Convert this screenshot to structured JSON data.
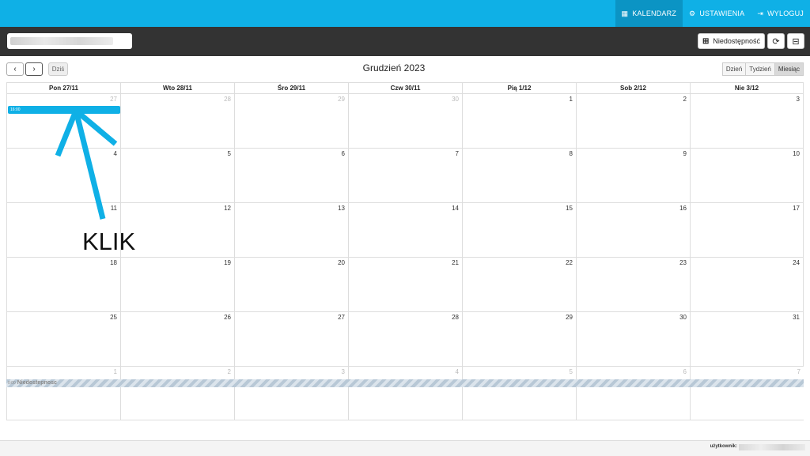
{
  "nav": {
    "items": [
      {
        "label": "KALENDARZ",
        "icon": "calendar-icon",
        "glyph": "▦",
        "active": true
      },
      {
        "label": "USTAWIENIA",
        "icon": "gears-icon",
        "glyph": "⚙",
        "active": false
      },
      {
        "label": "WYLOGUJ",
        "icon": "sign-out-icon",
        "glyph": "⇥",
        "active": false
      }
    ]
  },
  "toolbar": {
    "search_value": "",
    "unavailability_label": "Niedostępność",
    "unavailability_icon": "plus-square-icon",
    "refresh_icon": "refresh-icon",
    "grid_icon": "table-icon"
  },
  "calendar": {
    "title": "Grudzień 2023",
    "today_label": "Dziś",
    "prev_icon": "chevron-left-icon",
    "next_icon": "chevron-right-icon",
    "views": [
      {
        "label": "Dzień",
        "active": false
      },
      {
        "label": "Tydzień",
        "active": false
      },
      {
        "label": "Miesiąc",
        "active": true
      }
    ],
    "weekdays": [
      "Pon 27/11",
      "Wto 28/11",
      "Śro 29/11",
      "Czw 30/11",
      "Pią 1/12",
      "Sob 2/12",
      "Nie 3/12"
    ],
    "weeks": [
      [
        {
          "d": "27",
          "other": true
        },
        {
          "d": "28",
          "other": true
        },
        {
          "d": "29",
          "other": true
        },
        {
          "d": "30",
          "other": true
        },
        {
          "d": "1",
          "other": false
        },
        {
          "d": "2",
          "other": false
        },
        {
          "d": "3",
          "other": false
        }
      ],
      [
        {
          "d": "4",
          "other": false
        },
        {
          "d": "5",
          "other": false
        },
        {
          "d": "6",
          "other": false
        },
        {
          "d": "7",
          "other": false
        },
        {
          "d": "8",
          "other": false
        },
        {
          "d": "9",
          "other": false
        },
        {
          "d": "10",
          "other": false
        }
      ],
      [
        {
          "d": "11",
          "other": false
        },
        {
          "d": "12",
          "other": false
        },
        {
          "d": "13",
          "other": false
        },
        {
          "d": "14",
          "other": false
        },
        {
          "d": "15",
          "other": false
        },
        {
          "d": "16",
          "other": false
        },
        {
          "d": "17",
          "other": false
        }
      ],
      [
        {
          "d": "18",
          "other": false
        },
        {
          "d": "19",
          "other": false
        },
        {
          "d": "20",
          "other": false
        },
        {
          "d": "21",
          "other": false
        },
        {
          "d": "22",
          "other": false
        },
        {
          "d": "23",
          "other": false
        },
        {
          "d": "24",
          "other": false
        }
      ],
      [
        {
          "d": "25",
          "other": false
        },
        {
          "d": "26",
          "other": false
        },
        {
          "d": "27",
          "other": false
        },
        {
          "d": "28",
          "other": false
        },
        {
          "d": "29",
          "other": false
        },
        {
          "d": "30",
          "other": false
        },
        {
          "d": "31",
          "other": false
        }
      ],
      [
        {
          "d": "1",
          "other": true
        },
        {
          "d": "2",
          "other": true
        },
        {
          "d": "3",
          "other": true
        },
        {
          "d": "4",
          "other": true
        },
        {
          "d": "5",
          "other": true
        },
        {
          "d": "6",
          "other": true
        },
        {
          "d": "7",
          "other": true
        }
      ]
    ],
    "event_first": {
      "time": "16:00",
      "color": "#0fb0e6"
    },
    "event_unavailable": {
      "time": "0:00",
      "label": "Niedostepnosc"
    }
  },
  "annotation": {
    "text": "KLIK",
    "color": "#0fb0e6"
  },
  "footer": {
    "user_label": "użytkownik:"
  },
  "colors": {
    "accent": "#0fb0e6",
    "accent_dark": "#0b94c4",
    "toolbar": "#333333"
  }
}
